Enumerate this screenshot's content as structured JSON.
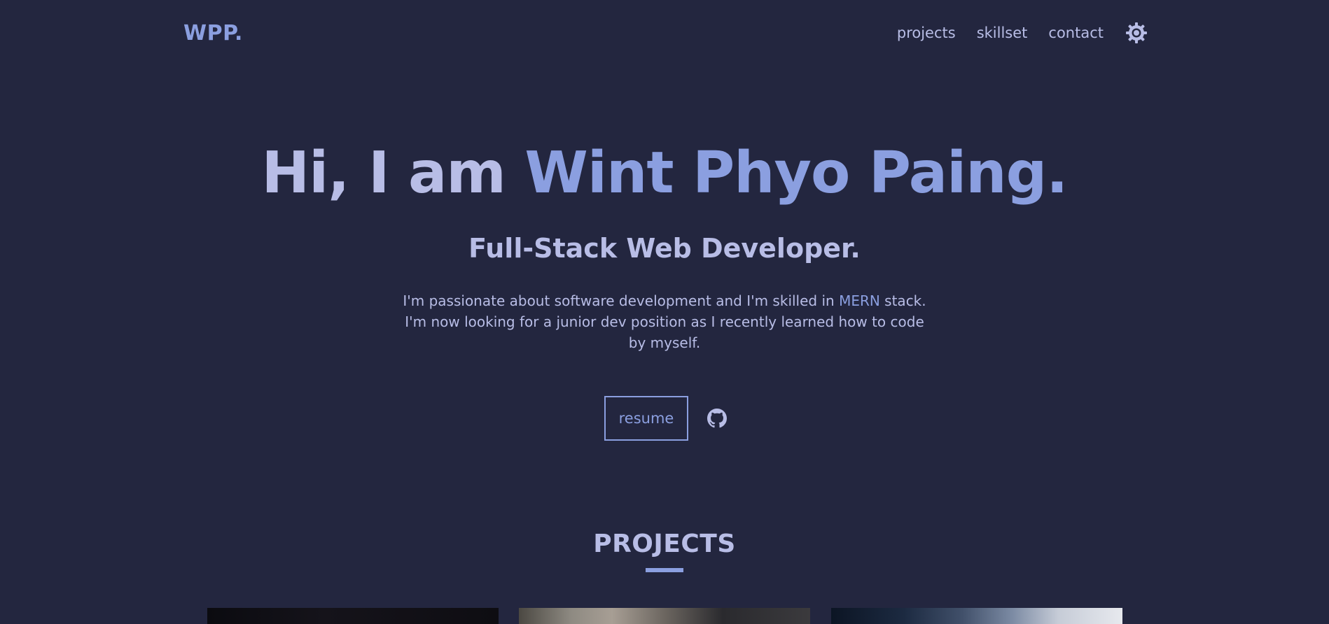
{
  "header": {
    "logo": "WPP.",
    "nav": {
      "projects": "projects",
      "skillset": "skillset",
      "contact": "contact"
    },
    "theme_icon": "sun-gear-icon"
  },
  "hero": {
    "title_prefix": "Hi, I am",
    "title_name": "Wint Phyo Paing.",
    "subtitle": "Full-Stack Web Developer.",
    "desc_part1": "I'm passionate about software development and I'm skilled in",
    "desc_highlight": "MERN",
    "desc_part2": "stack. I'm now looking for a junior dev position as I recently learned how to code by myself.",
    "resume_label": "resume",
    "github_icon": "github-icon"
  },
  "projects_section": {
    "title": "PROJECTS"
  },
  "colors": {
    "background": "#23263f",
    "text": "#b8bde6",
    "accent": "#8b9fe0"
  }
}
